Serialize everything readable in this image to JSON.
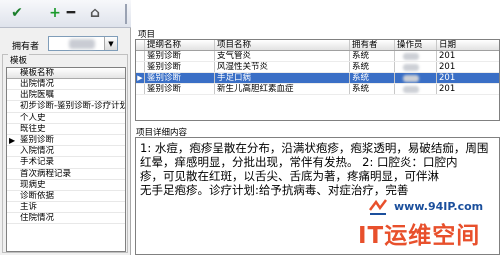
{
  "toolbar": {
    "buttons": [
      {
        "icon": "checkmark-icon",
        "glyph": "✔",
        "color": "#1b7f2c"
      },
      {
        "icon": "add-icon",
        "glyph": "+",
        "color": "#1b9a2c"
      },
      {
        "icon": "remove-icon",
        "glyph": "━",
        "color": "#222222"
      },
      {
        "icon": "template-icon",
        "glyph": "⌂",
        "color": "#555555"
      }
    ]
  },
  "left_panel": {
    "owner_label": "拥有者",
    "owner_arrow": "▼",
    "template_group_title": "模板",
    "template_header": "模板名称",
    "selected_marker": "▶",
    "templates": [
      "出院情况",
      "出院医嘱",
      "初步诊断-鉴别诊断-诊疗计划",
      "个人史",
      "既往史",
      "鉴别诊断",
      "入院情况",
      "手术记录",
      "首次病程记录",
      "现病史",
      "诊断依据",
      "主诉",
      "住院情况"
    ],
    "selected_index": 5
  },
  "project": {
    "title": "项目",
    "columns": [
      "提纲名称",
      "项目名称",
      "拥有者",
      "操作员",
      "日期"
    ],
    "rows": [
      {
        "outline": "鉴别诊断",
        "name": "支气管炎",
        "owner": "系统",
        "date": "201"
      },
      {
        "outline": "鉴别诊断",
        "name": "风湿性关节炎",
        "owner": "系统",
        "date": "201"
      },
      {
        "outline": "鉴别诊断",
        "name": "手足口病",
        "owner": "系统",
        "date": "201"
      },
      {
        "outline": "鉴别诊断",
        "name": "新生儿高胆红素血症",
        "owner": "系统",
        "date": "201"
      }
    ],
    "selected_index": 2,
    "selected_marker": "▶"
  },
  "detail": {
    "title": "项目详细内容",
    "lines": [
      "1: 水痘，疱疹呈散在分布，沿满状疱疹，疱浆透明，易破结痂，周围",
      "红晕，痒感明显，分批出现，常伴有发热。 2: 口腔炎：口腔内",
      "疹，可见散在红斑，以舌尖、舌底为著，疼痛明显，可伴淋",
      "无手足疱疹。诊疗计划:给予抗病毒、对症治疗，完善"
    ]
  },
  "watermark": {
    "url": "www.94IP.com",
    "text": "IT运维空间",
    "url_color": "#1b4f9c",
    "text_color": "#e8502c"
  },
  "colors": {
    "selection": "#3a6fc6"
  }
}
